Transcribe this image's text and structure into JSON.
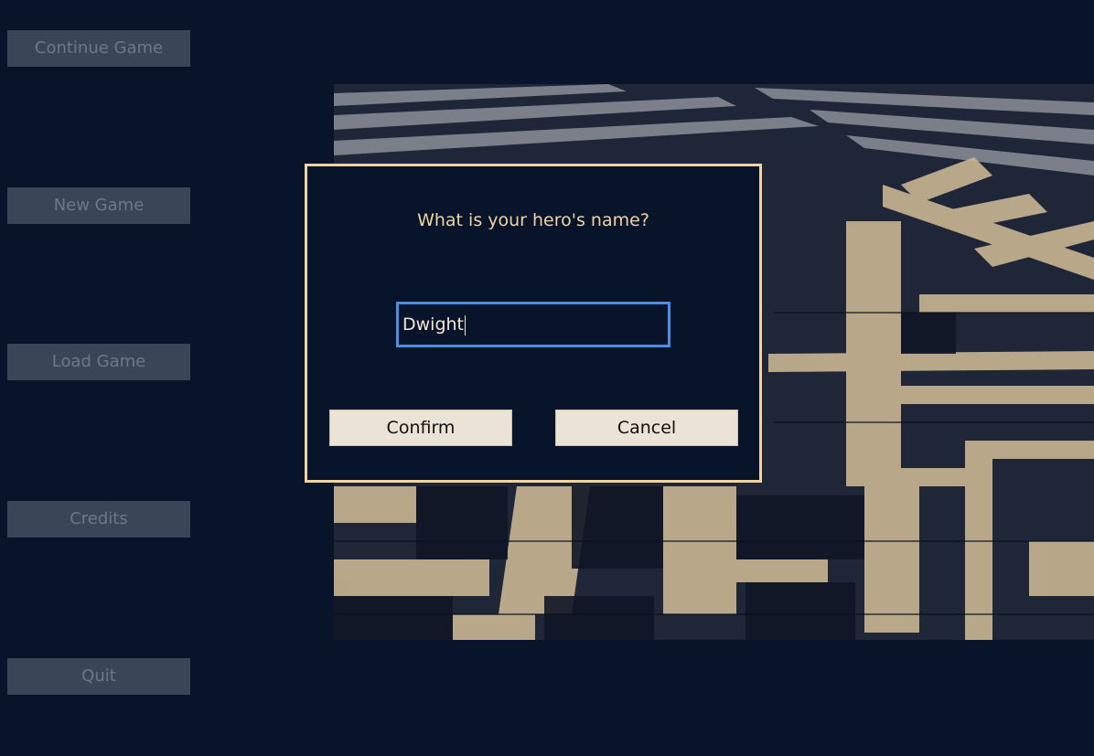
{
  "menu": {
    "items": [
      {
        "label": "Continue Game"
      },
      {
        "label": "New Game"
      },
      {
        "label": "Load Game"
      },
      {
        "label": "Credits"
      },
      {
        "label": "Quit"
      }
    ]
  },
  "dialog": {
    "title": "What is your hero's name?",
    "input_value": "Dwight",
    "confirm_label": "Confirm",
    "cancel_label": "Cancel"
  },
  "colors": {
    "background": "#08142a",
    "dialog_border": "#f3d3a5",
    "dialog_text": "#f1d2a5",
    "input_focus": "#4c8ee3",
    "button_bg": "#eae3d6",
    "menu_disabled": "#3a4658"
  }
}
